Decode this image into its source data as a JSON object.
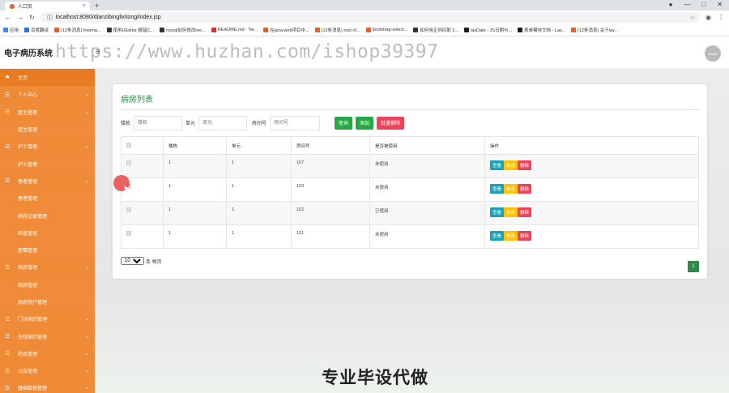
{
  "browser": {
    "tab_title": "人口页",
    "tab_close": "×",
    "new_tab": "+",
    "url": "localhost:8080/dianzibinglixitong/index.jsp",
    "bookmarks": [
      {
        "label": "应用",
        "color": "#4285f4"
      },
      {
        "label": "百度翻译",
        "color": "#2a6fdb"
      },
      {
        "label": "(12条消息) freema...",
        "color": "#e35d2d"
      },
      {
        "label": "使用UEditor 报错C...",
        "color": "#333333"
      },
      {
        "label": "mysql如何修改roo...",
        "color": "#333333"
      },
      {
        "label": "README.md - Ter...",
        "color": "#d93025"
      },
      {
        "label": "在java web项目中...",
        "color": "#e35d2d"
      },
      {
        "label": "(12条消息) root of...",
        "color": "#e35d2d"
      },
      {
        "label": "bootstrap-select...",
        "color": "#e35d2d"
      },
      {
        "label": "如何用正则匹配 2...",
        "color": "#333333"
      },
      {
        "label": "layDate - JS日期与...",
        "color": "#1e1e1e"
      },
      {
        "label": "表单模块文档 - Lay...",
        "color": "#1e1e1e"
      },
      {
        "label": "(12条消息) 关于lay...",
        "color": "#e35d2d"
      }
    ]
  },
  "header": {
    "brand": "电子病历系统",
    "menu_toggle": "≡",
    "avatar_text": "abode",
    "watermark": "https://www.huzhan.com/ishop39397"
  },
  "sidebar": {
    "items": [
      {
        "label": "主页",
        "type": "group",
        "icon": "⚑",
        "arrow": ""
      },
      {
        "label": "个人中心",
        "type": "group",
        "icon": "☰",
        "arrow": "⌄"
      },
      {
        "label": "医生管理",
        "type": "group",
        "icon": "☰",
        "arrow": "⌄"
      },
      {
        "label": "医生管理",
        "type": "sub",
        "icon": "",
        "arrow": ""
      },
      {
        "label": "护士管理",
        "type": "group",
        "icon": "☰",
        "arrow": "⌄"
      },
      {
        "label": "护士管理",
        "type": "sub",
        "icon": "",
        "arrow": ""
      },
      {
        "label": "患者管理",
        "type": "group",
        "icon": "☰",
        "arrow": "⌄"
      },
      {
        "label": "患者管理",
        "type": "sub",
        "icon": "",
        "arrow": ""
      },
      {
        "label": "病程记录管理",
        "type": "sub",
        "icon": "",
        "arrow": ""
      },
      {
        "label": "检查管理",
        "type": "sub",
        "icon": "",
        "arrow": ""
      },
      {
        "label": "医嘱管理",
        "type": "sub",
        "icon": "",
        "arrow": ""
      },
      {
        "label": "病房管理",
        "type": "group",
        "icon": "☰",
        "arrow": "⌄"
      },
      {
        "label": "病房管理",
        "type": "sub",
        "icon": "",
        "arrow": ""
      },
      {
        "label": "病房用户管理",
        "type": "sub",
        "icon": "",
        "arrow": ""
      },
      {
        "label": "门诊病历管理",
        "type": "group",
        "icon": "☰",
        "arrow": "⌄"
      },
      {
        "label": "住院病历管理",
        "type": "group",
        "icon": "☰",
        "arrow": "⌄"
      },
      {
        "label": "药品管理",
        "type": "group",
        "icon": "☰",
        "arrow": "⌄"
      },
      {
        "label": "公告管理",
        "type": "group",
        "icon": "☰",
        "arrow": "⌄"
      },
      {
        "label": "基础数据管理",
        "type": "group",
        "icon": "☰",
        "arrow": "⌄"
      }
    ]
  },
  "page": {
    "title": "病房列表",
    "search": {
      "building_label": "楼栋",
      "building_placeholder": "楼栋",
      "unit_label": "单元",
      "unit_placeholder": "单元",
      "room_label": "房间号",
      "room_placeholder": "房间号",
      "search_btn": "查询",
      "add_btn": "添加",
      "batch_delete_btn": "批量删除"
    },
    "table": {
      "headers": [
        "",
        "楼栋",
        "单元",
        "房间号",
        "是否被使用",
        "操作"
      ],
      "rows": [
        {
          "building": "1",
          "unit": "1",
          "room": "107",
          "used": "未使用"
        },
        {
          "building": "1",
          "unit": "1",
          "room": "103",
          "used": "未使用"
        },
        {
          "building": "1",
          "unit": "1",
          "room": "102",
          "used": "已使用"
        },
        {
          "building": "1",
          "unit": "1",
          "room": "101",
          "used": "未使用"
        }
      ],
      "actions": {
        "view": "查看",
        "edit": "修改",
        "delete": "删除"
      }
    },
    "pager": {
      "page_size": "10",
      "per_page_label": "条 每页",
      "current_page": "1"
    },
    "promo_text": "专业毕设代做"
  }
}
